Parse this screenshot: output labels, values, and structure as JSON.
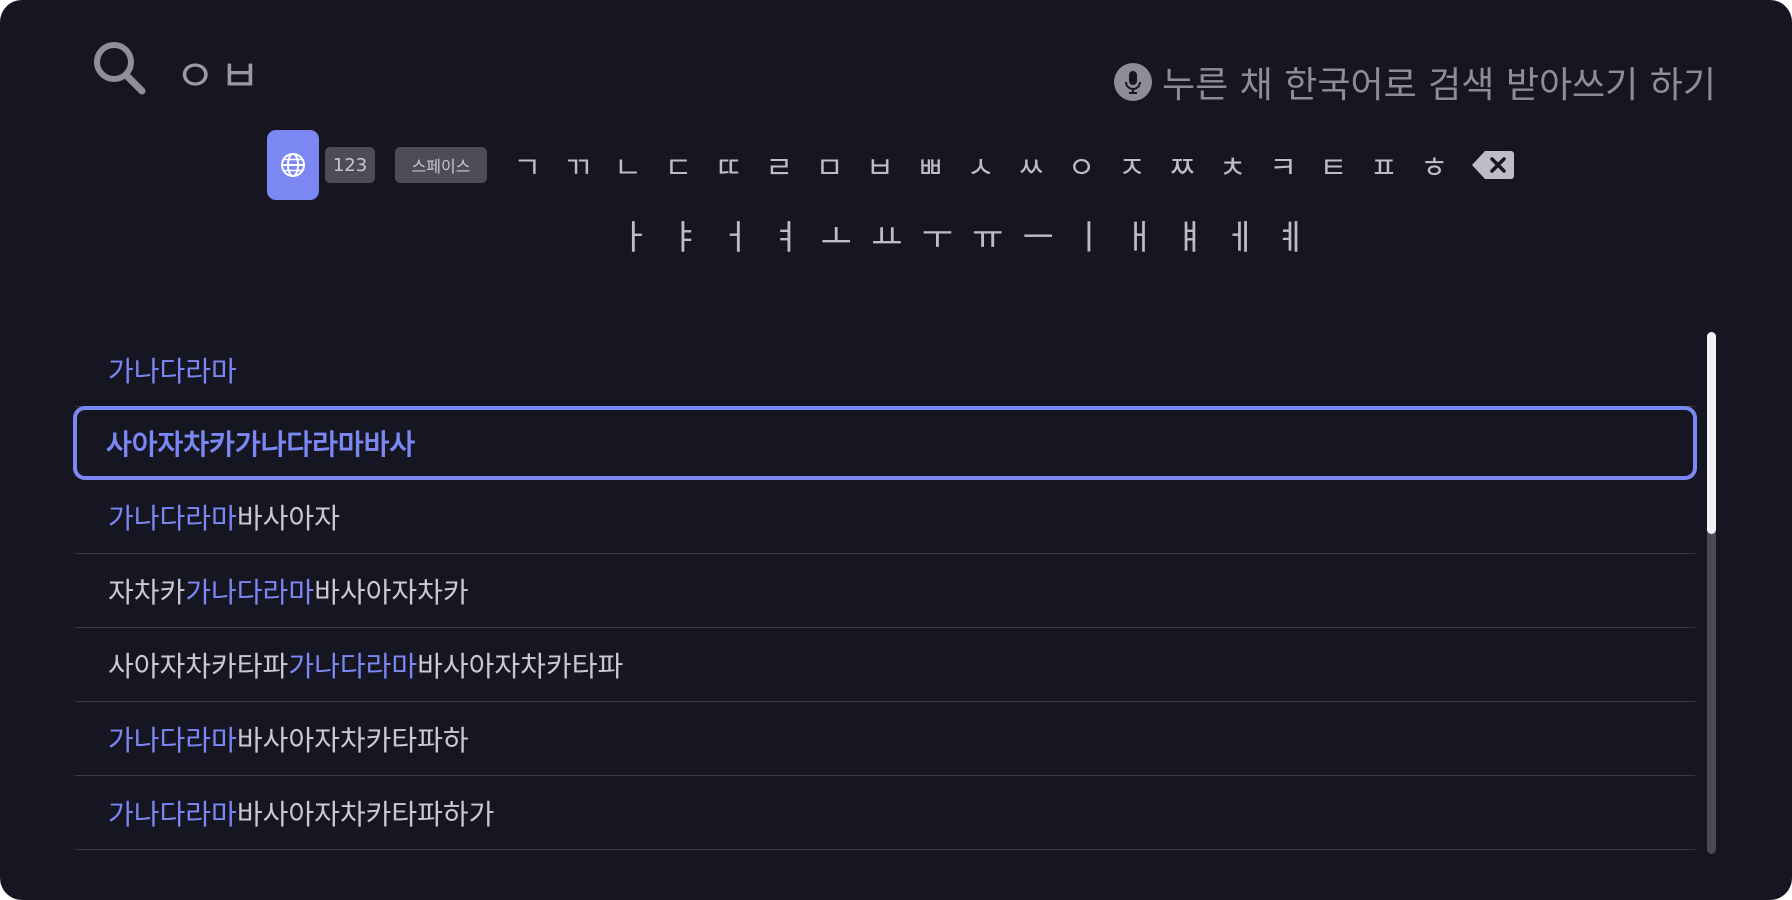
{
  "search": {
    "query": "ㅇㅂ"
  },
  "voice_hint": {
    "text": "누른 채 한국어로 검색 받아쓰기 하기"
  },
  "keyboard": {
    "num_label": "123",
    "space_label": "스페이스",
    "consonants": [
      "ㄱ",
      "ㄲ",
      "ㄴ",
      "ㄷ",
      "ㄸ",
      "ㄹ",
      "ㅁ",
      "ㅂ",
      "ㅃ",
      "ㅅ",
      "ㅆ",
      "ㅇ",
      "ㅈ",
      "ㅉ",
      "ㅊ",
      "ㅋ",
      "ㅌ",
      "ㅍ",
      "ㅎ"
    ],
    "vowels": [
      "ㅏ",
      "ㅑ",
      "ㅓ",
      "ㅕ",
      "ㅗ",
      "ㅛ",
      "ㅜ",
      "ㅠ",
      "ㅡ",
      "ㅣ",
      "ㅐ",
      "ㅒ",
      "ㅔ",
      "ㅖ"
    ]
  },
  "results": [
    {
      "pre": "",
      "highlight": "가나다라마",
      "post": ""
    },
    {
      "pre": "사아자차카",
      "highlight": "가나다라마",
      "post": "바사",
      "selected": true
    },
    {
      "pre": "",
      "highlight": "가나다라마",
      "post": "바사아자"
    },
    {
      "pre": "자차카",
      "highlight": "가나다라마",
      "post": "바사아자차카"
    },
    {
      "pre": "사아자차카타파",
      "highlight": "가나다라마",
      "post": "바사아자차카타파"
    },
    {
      "pre": "",
      "highlight": "가나다라마",
      "post": "바사아자차카타파하"
    },
    {
      "pre": "",
      "highlight": "가나다라마",
      "post": "바사아자차카타파하가"
    }
  ],
  "colors": {
    "accent": "#7b87f2",
    "background": "#161622"
  }
}
